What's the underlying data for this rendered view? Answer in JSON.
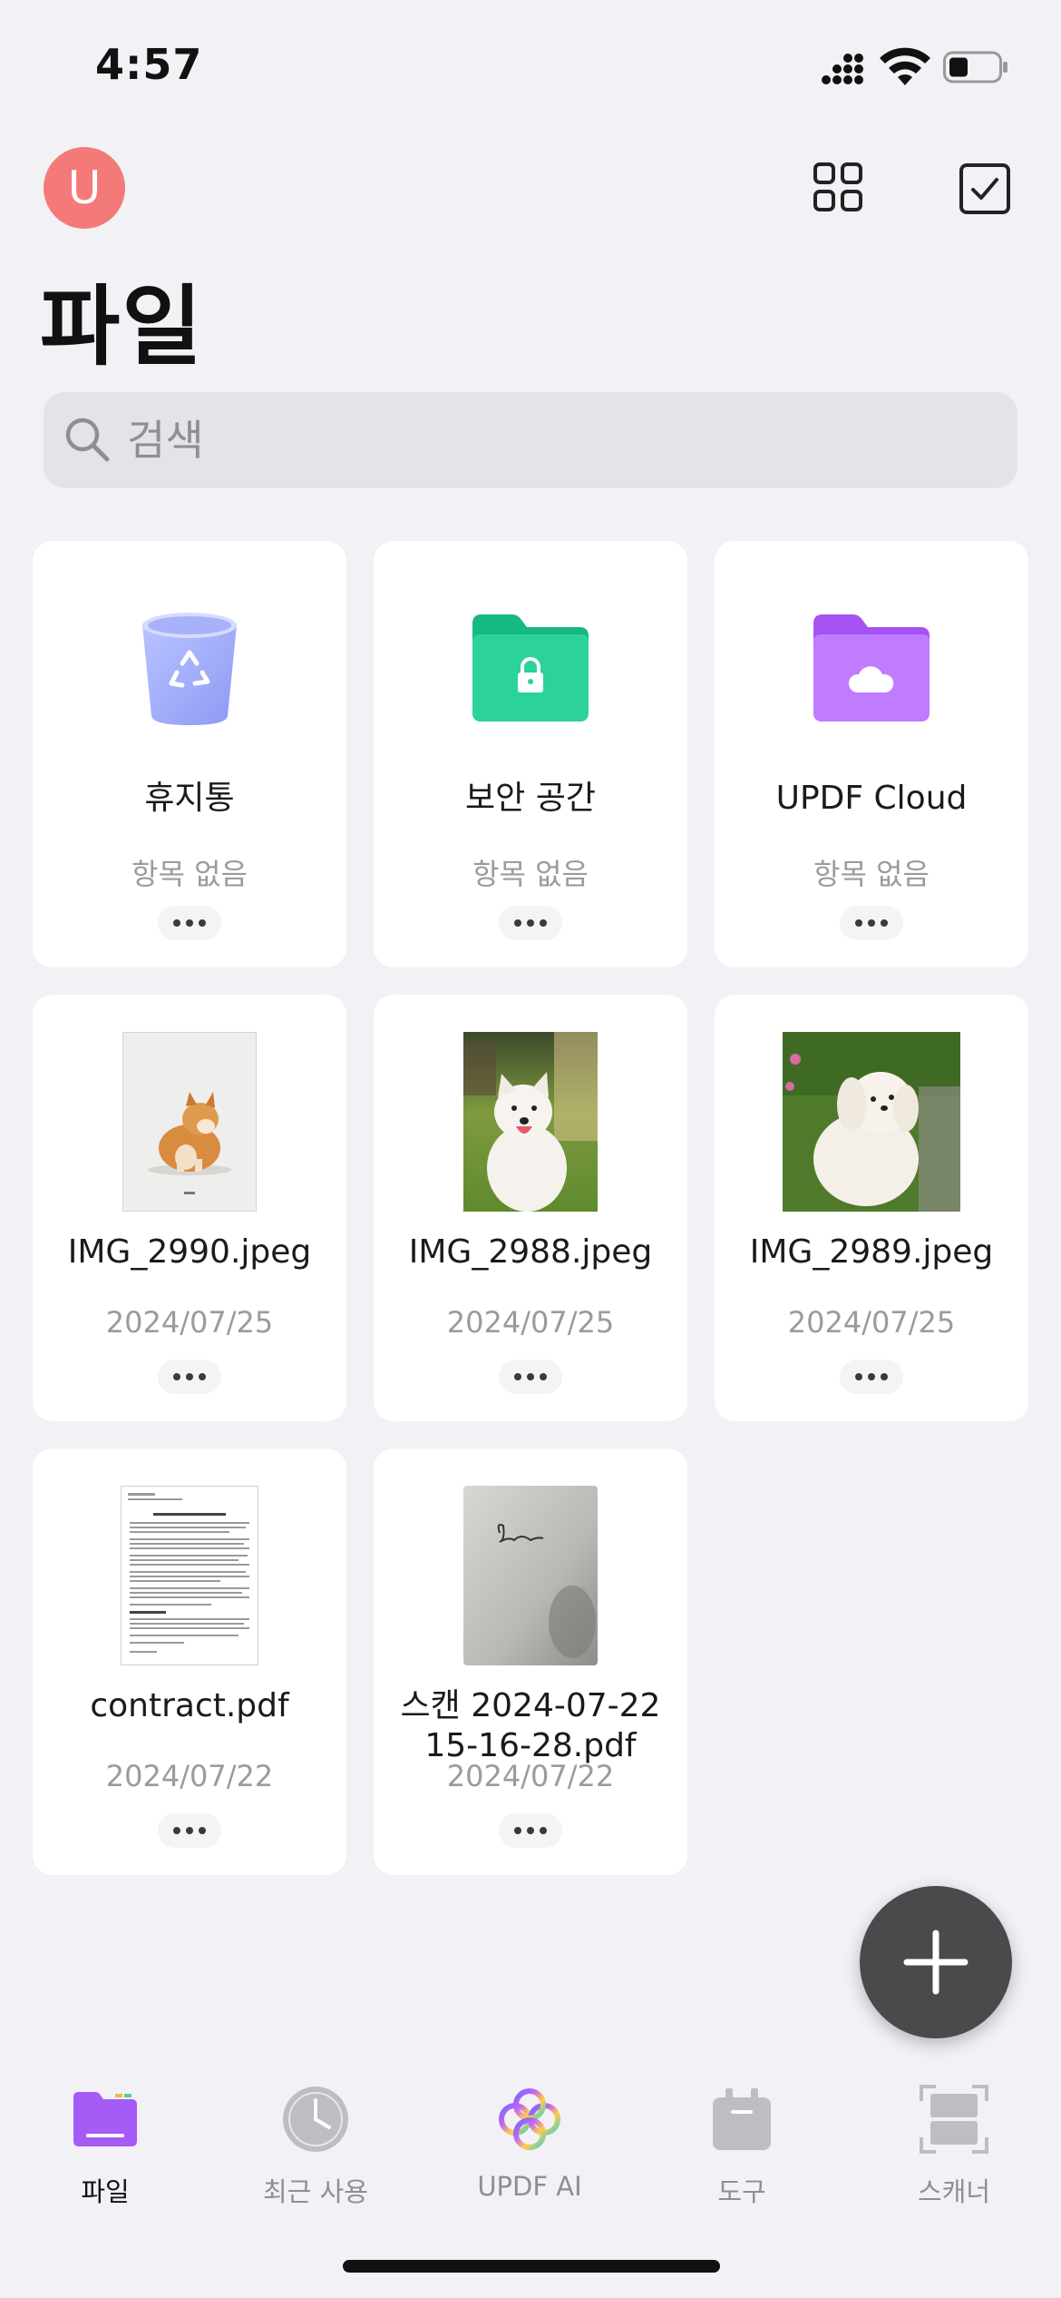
{
  "status_bar": {
    "time": "4:57"
  },
  "header": {
    "avatar_letter": "U",
    "title": "파일"
  },
  "search": {
    "placeholder": "검색"
  },
  "cards": [
    {
      "name": "휴지통",
      "sub": "항목 없음",
      "icon": "trash-bin-icon"
    },
    {
      "name": "보안 공간",
      "sub": "항목 없음",
      "icon": "lock-folder-icon"
    },
    {
      "name": "UPDF Cloud",
      "sub": "항목 없음",
      "icon": "cloud-folder-icon"
    },
    {
      "name": "IMG_2990.jpeg",
      "sub": "2024/07/25",
      "icon": "shiba-photo-thumbnail"
    },
    {
      "name": "IMG_2988.jpeg",
      "sub": "2024/07/25",
      "icon": "samoyed-photo-thumbnail"
    },
    {
      "name": "IMG_2989.jpeg",
      "sub": "2024/07/25",
      "icon": "white-dog-photo-thumbnail"
    },
    {
      "name": "contract.pdf",
      "sub": "2024/07/22",
      "icon": "pdf-document-thumbnail"
    },
    {
      "name_line1": "스캔 2024-07-22",
      "name_line2": "15-16-28.pdf",
      "sub": "2024/07/22",
      "icon": "scan-thumbnail"
    }
  ],
  "tabbar": {
    "items": [
      {
        "label": "파일",
        "icon": "folder-icon",
        "active": true
      },
      {
        "label": "최근 사용",
        "icon": "clock-icon"
      },
      {
        "label": "UPDF AI",
        "icon": "ai-icon"
      },
      {
        "label": "도구",
        "icon": "toolbox-icon"
      },
      {
        "label": "스캐너",
        "icon": "scanner-icon"
      }
    ]
  },
  "colors": {
    "accent": "#a55bf6",
    "avatar": "#f47a79",
    "secure": "#1fc38e"
  }
}
